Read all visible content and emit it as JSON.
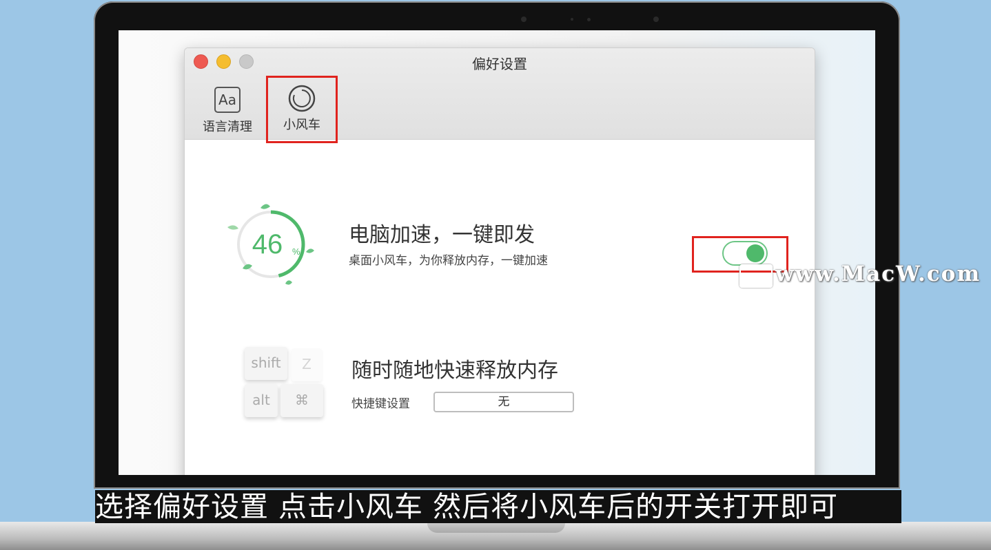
{
  "window": {
    "title": "偏好设置",
    "tabs": [
      {
        "label": "语言清理",
        "icon": "Aa"
      },
      {
        "label": "小风车"
      }
    ]
  },
  "boost": {
    "percent": "46",
    "percent_unit": "%",
    "percent_value": 0.46,
    "title": "电脑加速，一键即发",
    "subtitle": "桌面小风车，为你释放内存，一键加速",
    "toggle_on": true,
    "accent_color": "#4fb96b"
  },
  "release": {
    "title": "随时随地快速释放内存",
    "shortcut_label": "快捷键设置",
    "shortcut_value": "无",
    "keys": [
      "shift",
      "Z",
      "alt",
      "⌘"
    ]
  },
  "watermark": "www.MacW.com",
  "caption": "选择偏好设置 点击小风车 然后将小风车后的开关打开即可"
}
